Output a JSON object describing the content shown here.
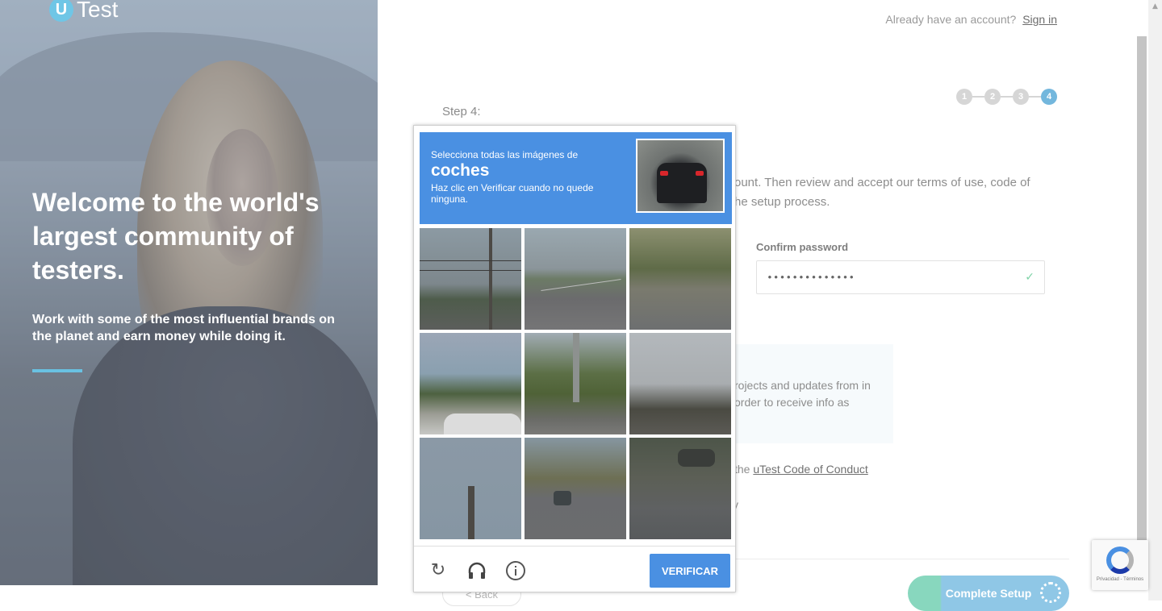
{
  "brand": {
    "logo_letter": "U",
    "name": "Test"
  },
  "hero": {
    "title": "Welcome to the world's largest community of testers.",
    "subtitle": "Work with some of the most influential brands on the planet and earn money while doing it."
  },
  "header": {
    "already_text": "Already have an account?",
    "sign_in": "Sign in"
  },
  "steps": {
    "labels": [
      "1",
      "2",
      "3",
      "4"
    ],
    "active": 4,
    "current_label": "Step 4:"
  },
  "form": {
    "description_line1": "ount. Then review and accept our terms of use, code of",
    "description_line2": "he setup process.",
    "confirm_password_label": "Confirm password",
    "confirm_password_value": "••••••••••••••",
    "info_text": "rojects and updates from in order to receive info as",
    "conduct_prefix": "the ",
    "conduct_link": "uTest Code of Conduct",
    "fragment": "y",
    "back_label": "< Back",
    "complete_label": "Complete Setup"
  },
  "captcha": {
    "instruction": "Selecciona todas las imágenes de",
    "target": "coches",
    "hint": "Haz clic en Verificar cuando no quede ninguna.",
    "verify_label": "VERIFICAR",
    "icons": [
      "reload-icon",
      "audio-icon",
      "info-icon"
    ]
  },
  "recaptcha_badge": {
    "terms": "Privacidad - Términos"
  },
  "colors": {
    "accent": "#4a90e2",
    "step_active": "#73b7dd",
    "brand": "#6fc6e6"
  }
}
